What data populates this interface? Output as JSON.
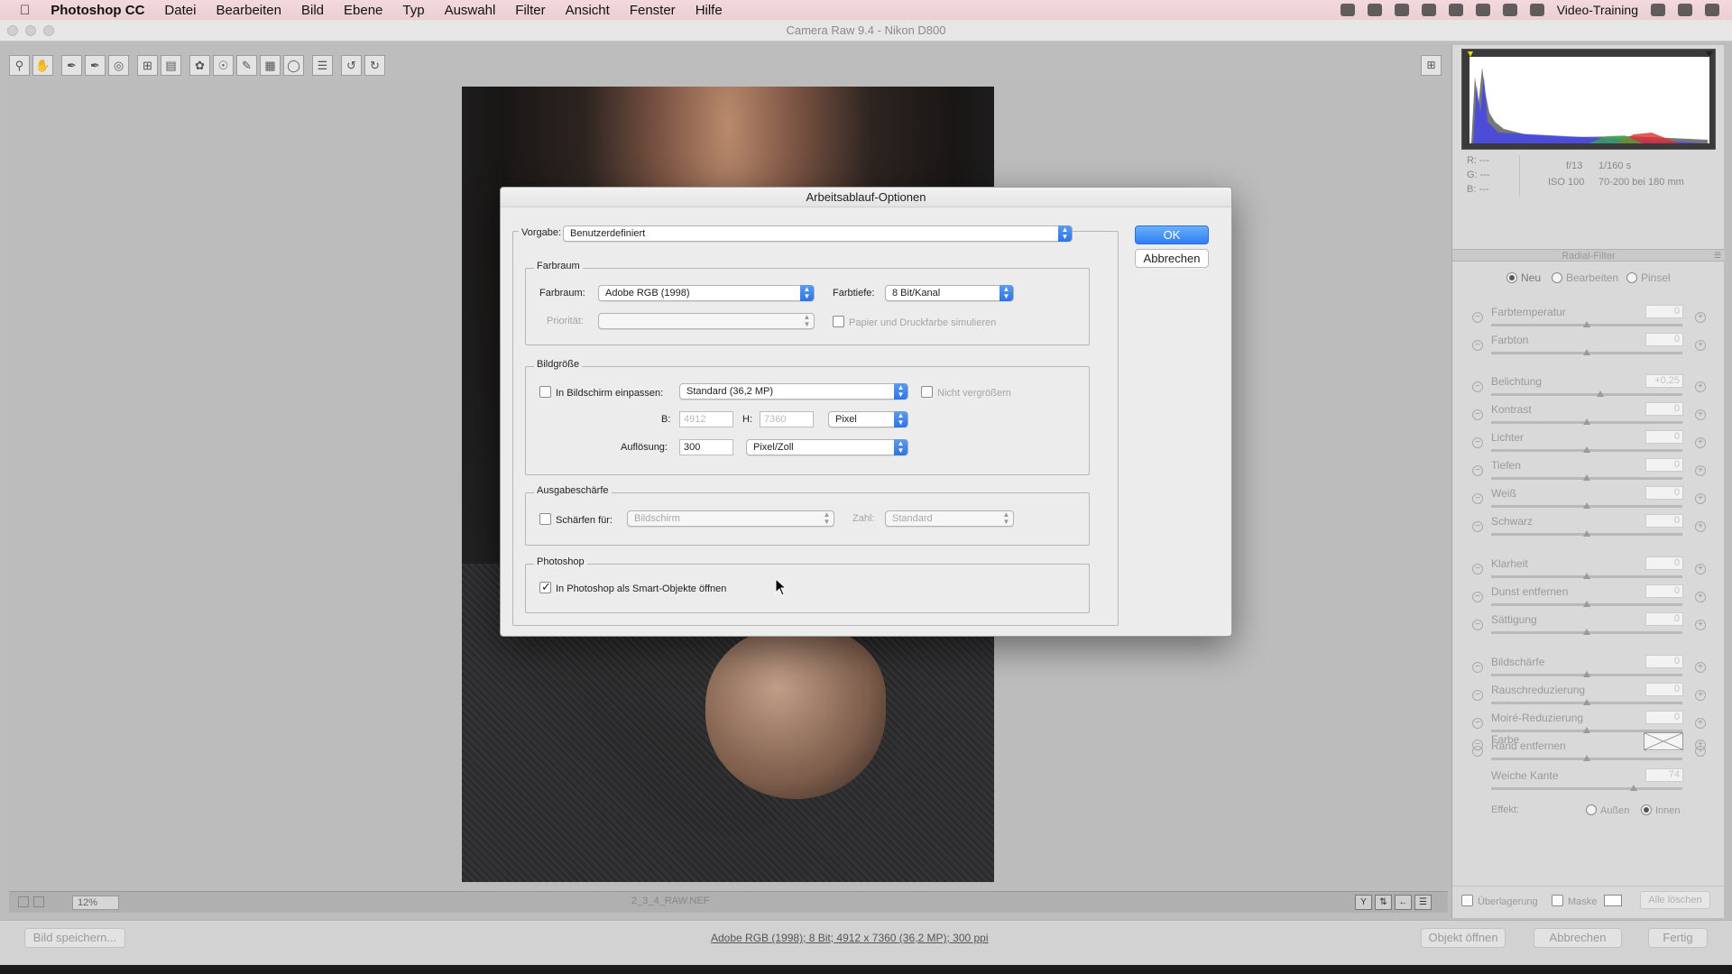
{
  "menubar": {
    "apple": "",
    "app_name": "Photoshop CC",
    "items": [
      "Datei",
      "Bearbeiten",
      "Bild",
      "Ebene",
      "Typ",
      "Auswahl",
      "Filter",
      "Ansicht",
      "Fenster",
      "Hilfe"
    ],
    "user": "Video-Training"
  },
  "window": {
    "title": "Camera Raw 9.4 - Nikon D800"
  },
  "toolbar": {
    "tools": [
      "zoom-icon",
      "hand-icon",
      "white-balance-icon",
      "color-sampler-icon",
      "target-adjust-icon",
      "crop-icon",
      "straighten-icon",
      "spot-removal-icon",
      "red-eye-icon",
      "adjustment-brush-icon",
      "graduated-filter-icon",
      "radial-filter-icon",
      "preferences-icon",
      "rotate-left-icon",
      "rotate-right-icon"
    ]
  },
  "histogram_info": {
    "r": "R:  ---",
    "g": "G:  ---",
    "b": "B:  ---",
    "aperture": "f/13",
    "shutter": "1/160 s",
    "iso": "ISO 100",
    "lens": "70-200 bei 180 mm"
  },
  "panel": {
    "title": "Radial-Filter",
    "modes": [
      "Neu",
      "Bearbeiten",
      "Pinsel"
    ],
    "sliders": [
      {
        "label": "Farbtemperatur",
        "value": "0"
      },
      {
        "label": "Farbton",
        "value": "0"
      },
      {
        "label": "Belichtung",
        "value": "+0,25"
      },
      {
        "label": "Kontrast",
        "value": "0"
      },
      {
        "label": "Lichter",
        "value": "0"
      },
      {
        "label": "Tiefen",
        "value": "0"
      },
      {
        "label": "Weiß",
        "value": "0"
      },
      {
        "label": "Schwarz",
        "value": "0"
      },
      {
        "label": "Klarheit",
        "value": "0"
      },
      {
        "label": "Dunst entfernen",
        "value": "0"
      },
      {
        "label": "Sättigung",
        "value": "0"
      },
      {
        "label": "Bildschärfe",
        "value": "0"
      },
      {
        "label": "Rauschreduzierung",
        "value": "0"
      },
      {
        "label": "Moiré-Reduzierung",
        "value": "0"
      },
      {
        "label": "Rand entfernen",
        "value": "0"
      }
    ],
    "color_label": "Farbe",
    "feather_label": "Weiche Kante",
    "feather_value": "74",
    "effect_label": "Effekt:",
    "effect_outside": "Außen",
    "effect_inside": "Innen",
    "overlay_label": "Überlagerung",
    "mask_label": "Maske",
    "clear_all": "Alle löschen"
  },
  "preview": {
    "zoom": "12%",
    "filename": "2_3_4_RAW.NEF"
  },
  "footer": {
    "save_button": "Bild speichern...",
    "workflow_info": "Adobe RGB (1998); 8 Bit; 4912 x 7360 (36,2 MP); 300 ppi",
    "open_object": "Objekt öffnen",
    "cancel": "Abbrechen",
    "done": "Fertig"
  },
  "dialog": {
    "title": "Arbeitsablauf-Optionen",
    "ok": "OK",
    "cancel": "Abbrechen",
    "preset_label": "Vorgabe:",
    "preset_value": "Benutzerdefiniert",
    "colorspace": {
      "legend": "Farbraum",
      "space_label": "Farbraum:",
      "space_value": "Adobe RGB (1998)",
      "depth_label": "Farbtiefe:",
      "depth_value": "8 Bit/Kanal",
      "priority_label": "Priorität:",
      "simulate_label": "Papier und Druckfarbe simulieren"
    },
    "imagesize": {
      "legend": "Bildgröße",
      "fit_label": "In Bildschirm einpassen:",
      "fit_value": "Standard  (36,2 MP)",
      "no_enlarge_label": "Nicht vergrößern",
      "w_label": "B:",
      "w_value": "4912",
      "h_label": "H:",
      "h_value": "7360",
      "unit_value": "Pixel",
      "res_label": "Auflösung:",
      "res_value": "300",
      "res_unit": "Pixel/Zoll"
    },
    "sharpen": {
      "legend": "Ausgabeschärfe",
      "sharpen_label": "Schärfen für:",
      "sharpen_value": "Bildschirm",
      "amount_label": "Zahl:",
      "amount_value": "Standard"
    },
    "photoshop": {
      "legend": "Photoshop",
      "smart_label": "In Photoshop als Smart-Objekte öffnen",
      "smart_checked": true
    }
  }
}
